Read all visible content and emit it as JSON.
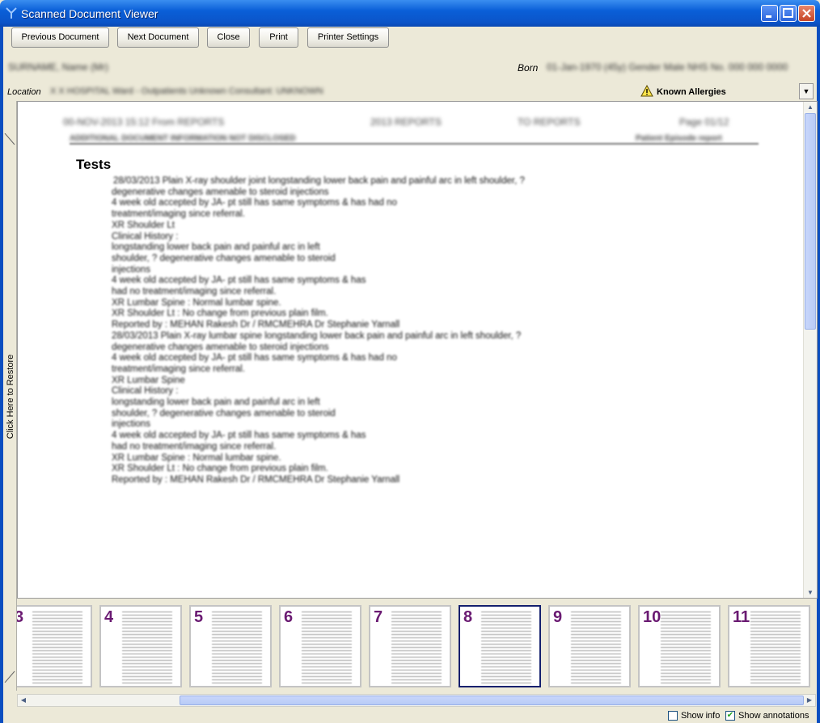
{
  "window": {
    "title": "Scanned Document Viewer"
  },
  "toolbar": {
    "prev": "Previous Document",
    "next": "Next Document",
    "close": "Close",
    "print": "Print",
    "printer_settings": "Printer Settings"
  },
  "patient": {
    "name": "SURNAME, Name (Mr)",
    "born_label": "Born",
    "born_value": "01-Jan-1970 (45y) Gender Male NHS No. 000 000 0000",
    "location_label": "Location",
    "location_value": "X X HOSPITAL Ward - Outpatients Unknown   Consultant: UNKNOWN",
    "allergies": "Known Allergies"
  },
  "side": {
    "restore": "Click Here to Restore"
  },
  "document": {
    "header_line1": [
      "00-NOV-2013 15:12 From REPORTS",
      "2013 REPORTS",
      "TO REPORTS",
      "Page 01/12"
    ],
    "header_line2": [
      "ADDITIONAL DOCUMENT INFORMATION NOT DISCLOSED",
      "Patient Episode report"
    ],
    "section_title": "Tests",
    "lines": [
      "28/03/2013 Plain X-ray shoulder joint longstanding lower back pain and painful arc in left shoulder, ?",
      "degenerative changes amenable to steroid injections",
      "4 week old accepted by JA- pt still has same symptoms & has had no",
      "treatment/imaging since referral.",
      "XR Shoulder Lt",
      "Clinical History :",
      "longstanding lower back pain and painful arc in left",
      "shoulder, ? degenerative changes amenable to steroid",
      "injections",
      "4 week old accepted by JA- pt still has same symptoms & has",
      "had no treatment/imaging since referral.",
      "XR Lumbar Spine : Normal lumbar spine.",
      "XR Shoulder Lt : No change from previous plain film.",
      "Reported by : MEHAN Rakesh Dr / RMCMEHRA Dr Stephanie Yarnall",
      "28/03/2013 Plain X-ray lumbar spine longstanding lower back pain and painful arc in left shoulder, ?",
      "degenerative changes amenable to steroid injections",
      "4 week old accepted by JA- pt still has same symptoms & has had no",
      "treatment/imaging since referral.",
      "XR Lumbar Spine",
      "Clinical History :",
      "longstanding lower back pain and painful arc in left",
      "shoulder, ? degenerative changes amenable to steroid",
      "injections",
      "4 week old accepted by JA- pt still has same symptoms & has",
      "had no treatment/imaging since referral.",
      "XR Lumbar Spine : Normal lumbar spine.",
      "XR Shoulder Lt : No change from previous plain film.",
      "Reported by : MEHAN Rakesh Dr / RMCMEHRA Dr Stephanie Yarnall"
    ]
  },
  "thumbnails": {
    "pages": [
      "3",
      "4",
      "5",
      "6",
      "7",
      "8",
      "9",
      "10",
      "11"
    ],
    "selected": "8"
  },
  "footer": {
    "show_info": "Show info",
    "show_info_checked": false,
    "show_annotations": "Show annotations",
    "show_annotations_checked": true
  }
}
